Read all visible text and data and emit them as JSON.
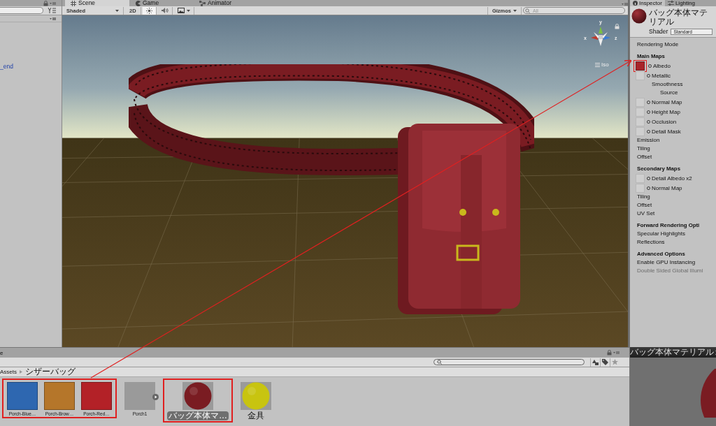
{
  "hierarchy": {
    "items": [
      {
        "label": "_end"
      }
    ]
  },
  "scene": {
    "tabs": [
      {
        "label": "Scene",
        "selected": true
      },
      {
        "label": "Game",
        "selected": false
      },
      {
        "label": "Animator",
        "selected": false
      }
    ],
    "draw_mode": "Shaded",
    "mode_2d": "2D",
    "lighting_on": true,
    "audio_on": false,
    "gizmos": "Gizmos",
    "search_placeholder": "All",
    "gizmo_axes": [
      {
        "label": "y"
      },
      {
        "label": "x"
      },
      {
        "label": "z"
      }
    ],
    "projection": "Iso"
  },
  "inspector": {
    "tabs": [
      {
        "label": "Inspector",
        "selected": true
      },
      {
        "label": "Lighting",
        "selected": false
      }
    ],
    "material_name": "バッグ本体マテリアル",
    "shader_label": "Shader",
    "shader": "Standard",
    "properties": [
      {
        "kind": "label",
        "label": "Rendering Mode",
        "disabled": false
      },
      {
        "kind": "header",
        "label": "Main Maps",
        "disabled": false
      },
      {
        "kind": "map",
        "label": "Albedo",
        "filled": true,
        "annotated": true,
        "disabled": false
      },
      {
        "kind": "map",
        "label": "Metallic",
        "filled": false,
        "annotated": false,
        "disabled": false
      },
      {
        "kind": "sub",
        "label": "Smoothness",
        "disabled": false
      },
      {
        "kind": "sub2",
        "label": "Source",
        "disabled": false
      },
      {
        "kind": "map",
        "label": "Normal Map",
        "filled": false,
        "annotated": false,
        "disabled": false
      },
      {
        "kind": "map",
        "label": "Height Map",
        "filled": false,
        "annotated": false,
        "disabled": false
      },
      {
        "kind": "map",
        "label": "Occlusion",
        "filled": false,
        "annotated": false,
        "disabled": false
      },
      {
        "kind": "map",
        "label": "Detail Mask",
        "filled": false,
        "annotated": false,
        "disabled": false
      },
      {
        "kind": "label",
        "label": "Emission",
        "disabled": false
      },
      {
        "kind": "label",
        "label": "Tiling",
        "disabled": false
      },
      {
        "kind": "label",
        "label": "Offset",
        "disabled": false
      },
      {
        "kind": "header",
        "label": "Secondary Maps",
        "disabled": false
      },
      {
        "kind": "map",
        "label": "Detail Albedo x2",
        "filled": false,
        "annotated": false,
        "disabled": false
      },
      {
        "kind": "map",
        "label": "Normal Map",
        "filled": false,
        "annotated": false,
        "disabled": false
      },
      {
        "kind": "label",
        "label": "Tiling",
        "disabled": false
      },
      {
        "kind": "label",
        "label": "Offset",
        "disabled": false
      },
      {
        "kind": "label",
        "label": "UV Set",
        "disabled": false
      },
      {
        "kind": "header",
        "label": "Forward Rendering Opti",
        "disabled": false
      },
      {
        "kind": "label",
        "label": "Specular Highlights",
        "disabled": false
      },
      {
        "kind": "label",
        "label": "Reflections",
        "disabled": false
      },
      {
        "kind": "header",
        "label": "Advanced Options",
        "disabled": false
      },
      {
        "kind": "label",
        "label": "Enable GPU Instancing",
        "disabled": false
      },
      {
        "kind": "label",
        "label": "Double Sided Global Illumi",
        "disabled": true
      }
    ]
  },
  "preview": {
    "title": "バッグ本体マテリアル"
  },
  "project": {
    "tab_label": "e",
    "breadcrumb": [
      "Assets",
      "シザーバッグ"
    ],
    "groups": [
      {
        "annotated": true,
        "items": [
          {
            "kind": "texture",
            "name": "Porch-Blue…",
            "color": "#2e67b0",
            "selected": false
          },
          {
            "kind": "texture",
            "name": "Porch-Brow…",
            "color": "#b5762a",
            "selected": false
          },
          {
            "kind": "texture",
            "name": "Porch-Red…",
            "color": "#b32127",
            "selected": false
          }
        ]
      },
      {
        "annotated": false,
        "items": [
          {
            "kind": "model",
            "name": "Porch1",
            "color": "#9a9a9a",
            "selected": false
          }
        ]
      },
      {
        "annotated": true,
        "items": [
          {
            "kind": "material",
            "name": "バッグ本体マ…",
            "color": "#7a1c22",
            "selected": true
          }
        ]
      },
      {
        "annotated": false,
        "items": [
          {
            "kind": "material",
            "name": "金具",
            "color": "#c8c410",
            "selected": false
          }
        ]
      }
    ]
  }
}
